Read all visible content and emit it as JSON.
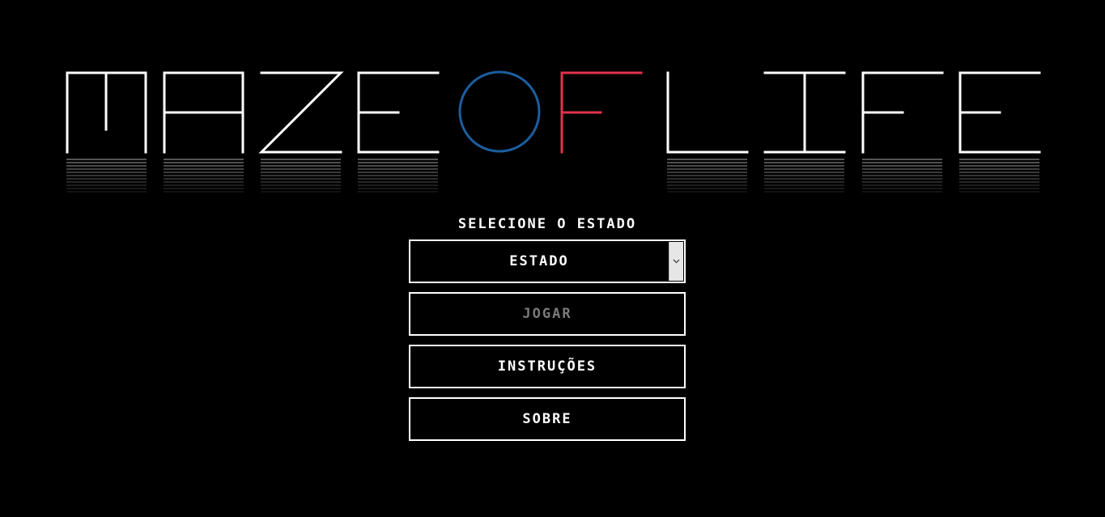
{
  "logo": {
    "text": "MAZE OF LIFE",
    "colors": {
      "letters": "#ffffff",
      "o_ring": "#1b5e9e",
      "f_letter": "#e0334d",
      "reflection": "#555555"
    }
  },
  "form": {
    "prompt": "SELECIONE O ESTADO",
    "select": {
      "value": "ESTADO",
      "arrow_icon": "chevron-down-icon"
    },
    "buttons": {
      "play": "JOGAR",
      "instructions": "INSTRUÇÕES",
      "about": "SOBRE"
    },
    "play_disabled": true
  }
}
